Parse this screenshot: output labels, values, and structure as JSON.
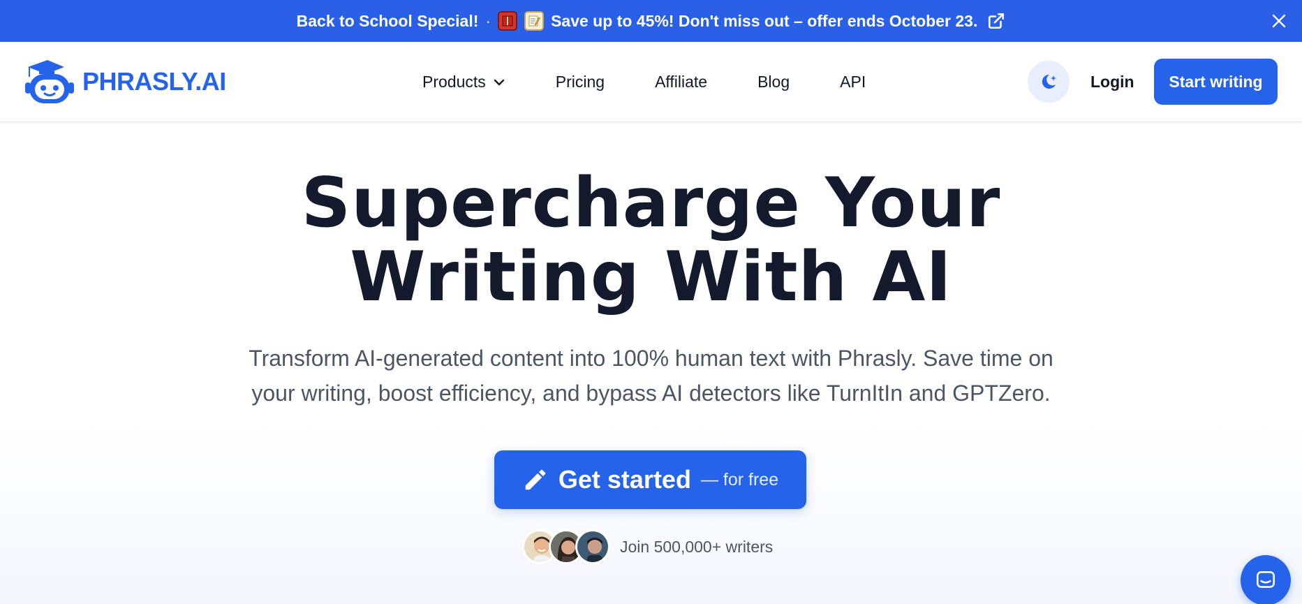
{
  "banner": {
    "lead": "Back to School Special!",
    "separator": "·",
    "emoji_1": "book-emoji",
    "emoji_2": "memo-emoji",
    "message": "Save up to 45%! Don't miss out – offer ends October 23.",
    "icon_external": "external-link-icon",
    "icon_close": "close-icon",
    "background_color": "#2a5fe8"
  },
  "header": {
    "logo_text": "PHRASLY.AI",
    "nav": [
      {
        "label": "Products",
        "has_dropdown": true
      },
      {
        "label": "Pricing"
      },
      {
        "label": "Affiliate"
      },
      {
        "label": "Blog"
      },
      {
        "label": "API"
      }
    ],
    "theme_icon": "moon-stars-icon",
    "login_label": "Login",
    "start_label": "Start writing"
  },
  "hero": {
    "title_line1": "Supercharge Your",
    "title_line2": "Writing With AI",
    "subtitle_line1": "Transform AI-generated content into 100% human text with Phrasly. Save time on",
    "subtitle_line2": "your writing, boost efficiency, and bypass AI detectors like TurnItIn and GPTZero.",
    "cta_label": "Get started",
    "cta_suffix": "— for free",
    "cta_icon": "pencil-icon",
    "social_text": "Join 500,000+ writers"
  },
  "chat": {
    "icon": "chat-bubble-icon"
  },
  "colors": {
    "accent": "#2563eb",
    "text_dark": "#131a2b",
    "text_muted": "#4b5563"
  }
}
